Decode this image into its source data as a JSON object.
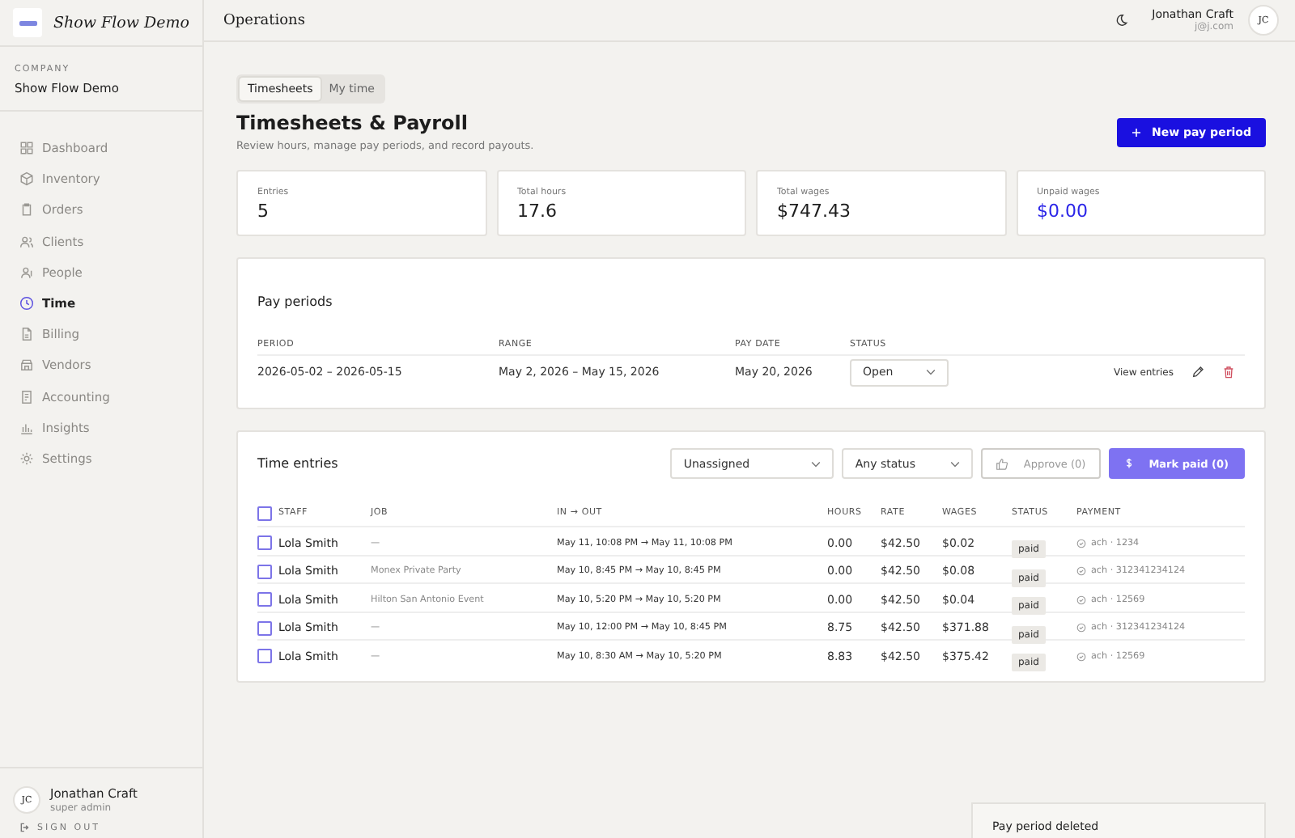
{
  "sidebar": {
    "brand": "Show Flow Demo",
    "company_label": "COMPANY",
    "company": "Show Flow Demo",
    "items": [
      {
        "label": "Dashboard",
        "selected": false
      },
      {
        "label": "Inventory",
        "selected": false
      },
      {
        "label": "Orders",
        "selected": false
      },
      {
        "label": "Clients",
        "selected": false
      },
      {
        "label": "People",
        "selected": false
      },
      {
        "label": "Time",
        "selected": true
      },
      {
        "label": "Billing",
        "selected": false
      },
      {
        "label": "Vendors",
        "selected": false
      },
      {
        "label": "Accounting",
        "selected": false
      },
      {
        "label": "Insights",
        "selected": false
      },
      {
        "label": "Settings",
        "selected": false
      }
    ],
    "user": {
      "initials": "JC",
      "name": "Jonathan Craft",
      "role": "super admin"
    },
    "sign_out": "SIGN OUT"
  },
  "header": {
    "title": "Operations",
    "user_name": "Jonathan Craft",
    "user_email": "j@j.com",
    "initials": "JC"
  },
  "tabs": [
    {
      "label": "Timesheets",
      "selected": true
    },
    {
      "label": "My time",
      "selected": false
    }
  ],
  "page": {
    "title": "Timesheets & Payroll",
    "subtitle": "Review hours, manage pay periods, and record payouts.",
    "new_button": "New pay period"
  },
  "stats": [
    {
      "label": "Entries",
      "value": "5",
      "accent": false
    },
    {
      "label": "Total hours",
      "value": "17.6",
      "accent": false
    },
    {
      "label": "Total wages",
      "value": "$747.43",
      "accent": false
    },
    {
      "label": "Unpaid wages",
      "value": "$0.00",
      "accent": true
    }
  ],
  "pay_periods": {
    "title": "Pay periods",
    "columns": [
      "PERIOD",
      "RANGE",
      "PAY DATE",
      "STATUS"
    ],
    "rows": [
      {
        "period": "2026-05-02 – 2026-05-15",
        "range": "May 2, 2026 – May 15, 2026",
        "pay_date": "May 20, 2026",
        "status": "Open",
        "action": "View entries"
      }
    ]
  },
  "time_entries": {
    "title": "Time entries",
    "filters": [
      "Unassigned",
      "Any status"
    ],
    "approve": "Approve (0)",
    "mark_paid": "Mark paid (0)",
    "all_checked": false,
    "columns": [
      "STAFF",
      "JOB",
      "IN → OUT",
      "HOURS",
      "RATE",
      "WAGES",
      "STATUS",
      "PAYMENT"
    ],
    "rows": [
      {
        "checked": false,
        "staff": "Lola Smith",
        "job": "—",
        "in_out": "May 11, 10:08 PM → May 11, 10:08 PM",
        "hours": "0.00",
        "rate": "$42.50",
        "wages": "$0.02",
        "status": "paid",
        "payment": "ach · 1234"
      },
      {
        "checked": false,
        "staff": "Lola Smith",
        "job": "Monex Private Party",
        "in_out": "May 10, 8:45 PM → May 10, 8:45 PM",
        "hours": "0.00",
        "rate": "$42.50",
        "wages": "$0.08",
        "status": "paid",
        "payment": "ach · 312341234124"
      },
      {
        "checked": false,
        "staff": "Lola Smith",
        "job": "Hilton San Antonio Event",
        "in_out": "May 10, 5:20 PM → May 10, 5:20 PM",
        "hours": "0.00",
        "rate": "$42.50",
        "wages": "$0.04",
        "status": "paid",
        "payment": "ach · 12569"
      },
      {
        "checked": false,
        "staff": "Lola Smith",
        "job": "—",
        "in_out": "May 10, 12:00 PM → May 10, 8:45 PM",
        "hours": "8.75",
        "rate": "$42.50",
        "wages": "$371.88",
        "status": "paid",
        "payment": "ach · 312341234124"
      },
      {
        "checked": false,
        "staff": "Lola Smith",
        "job": "—",
        "in_out": "May 10, 8:30 AM → May 10, 5:20 PM",
        "hours": "8.83",
        "rate": "$42.50",
        "wages": "$375.42",
        "status": "paid",
        "payment": "ach · 12569"
      }
    ]
  },
  "toast": "Pay period deleted"
}
